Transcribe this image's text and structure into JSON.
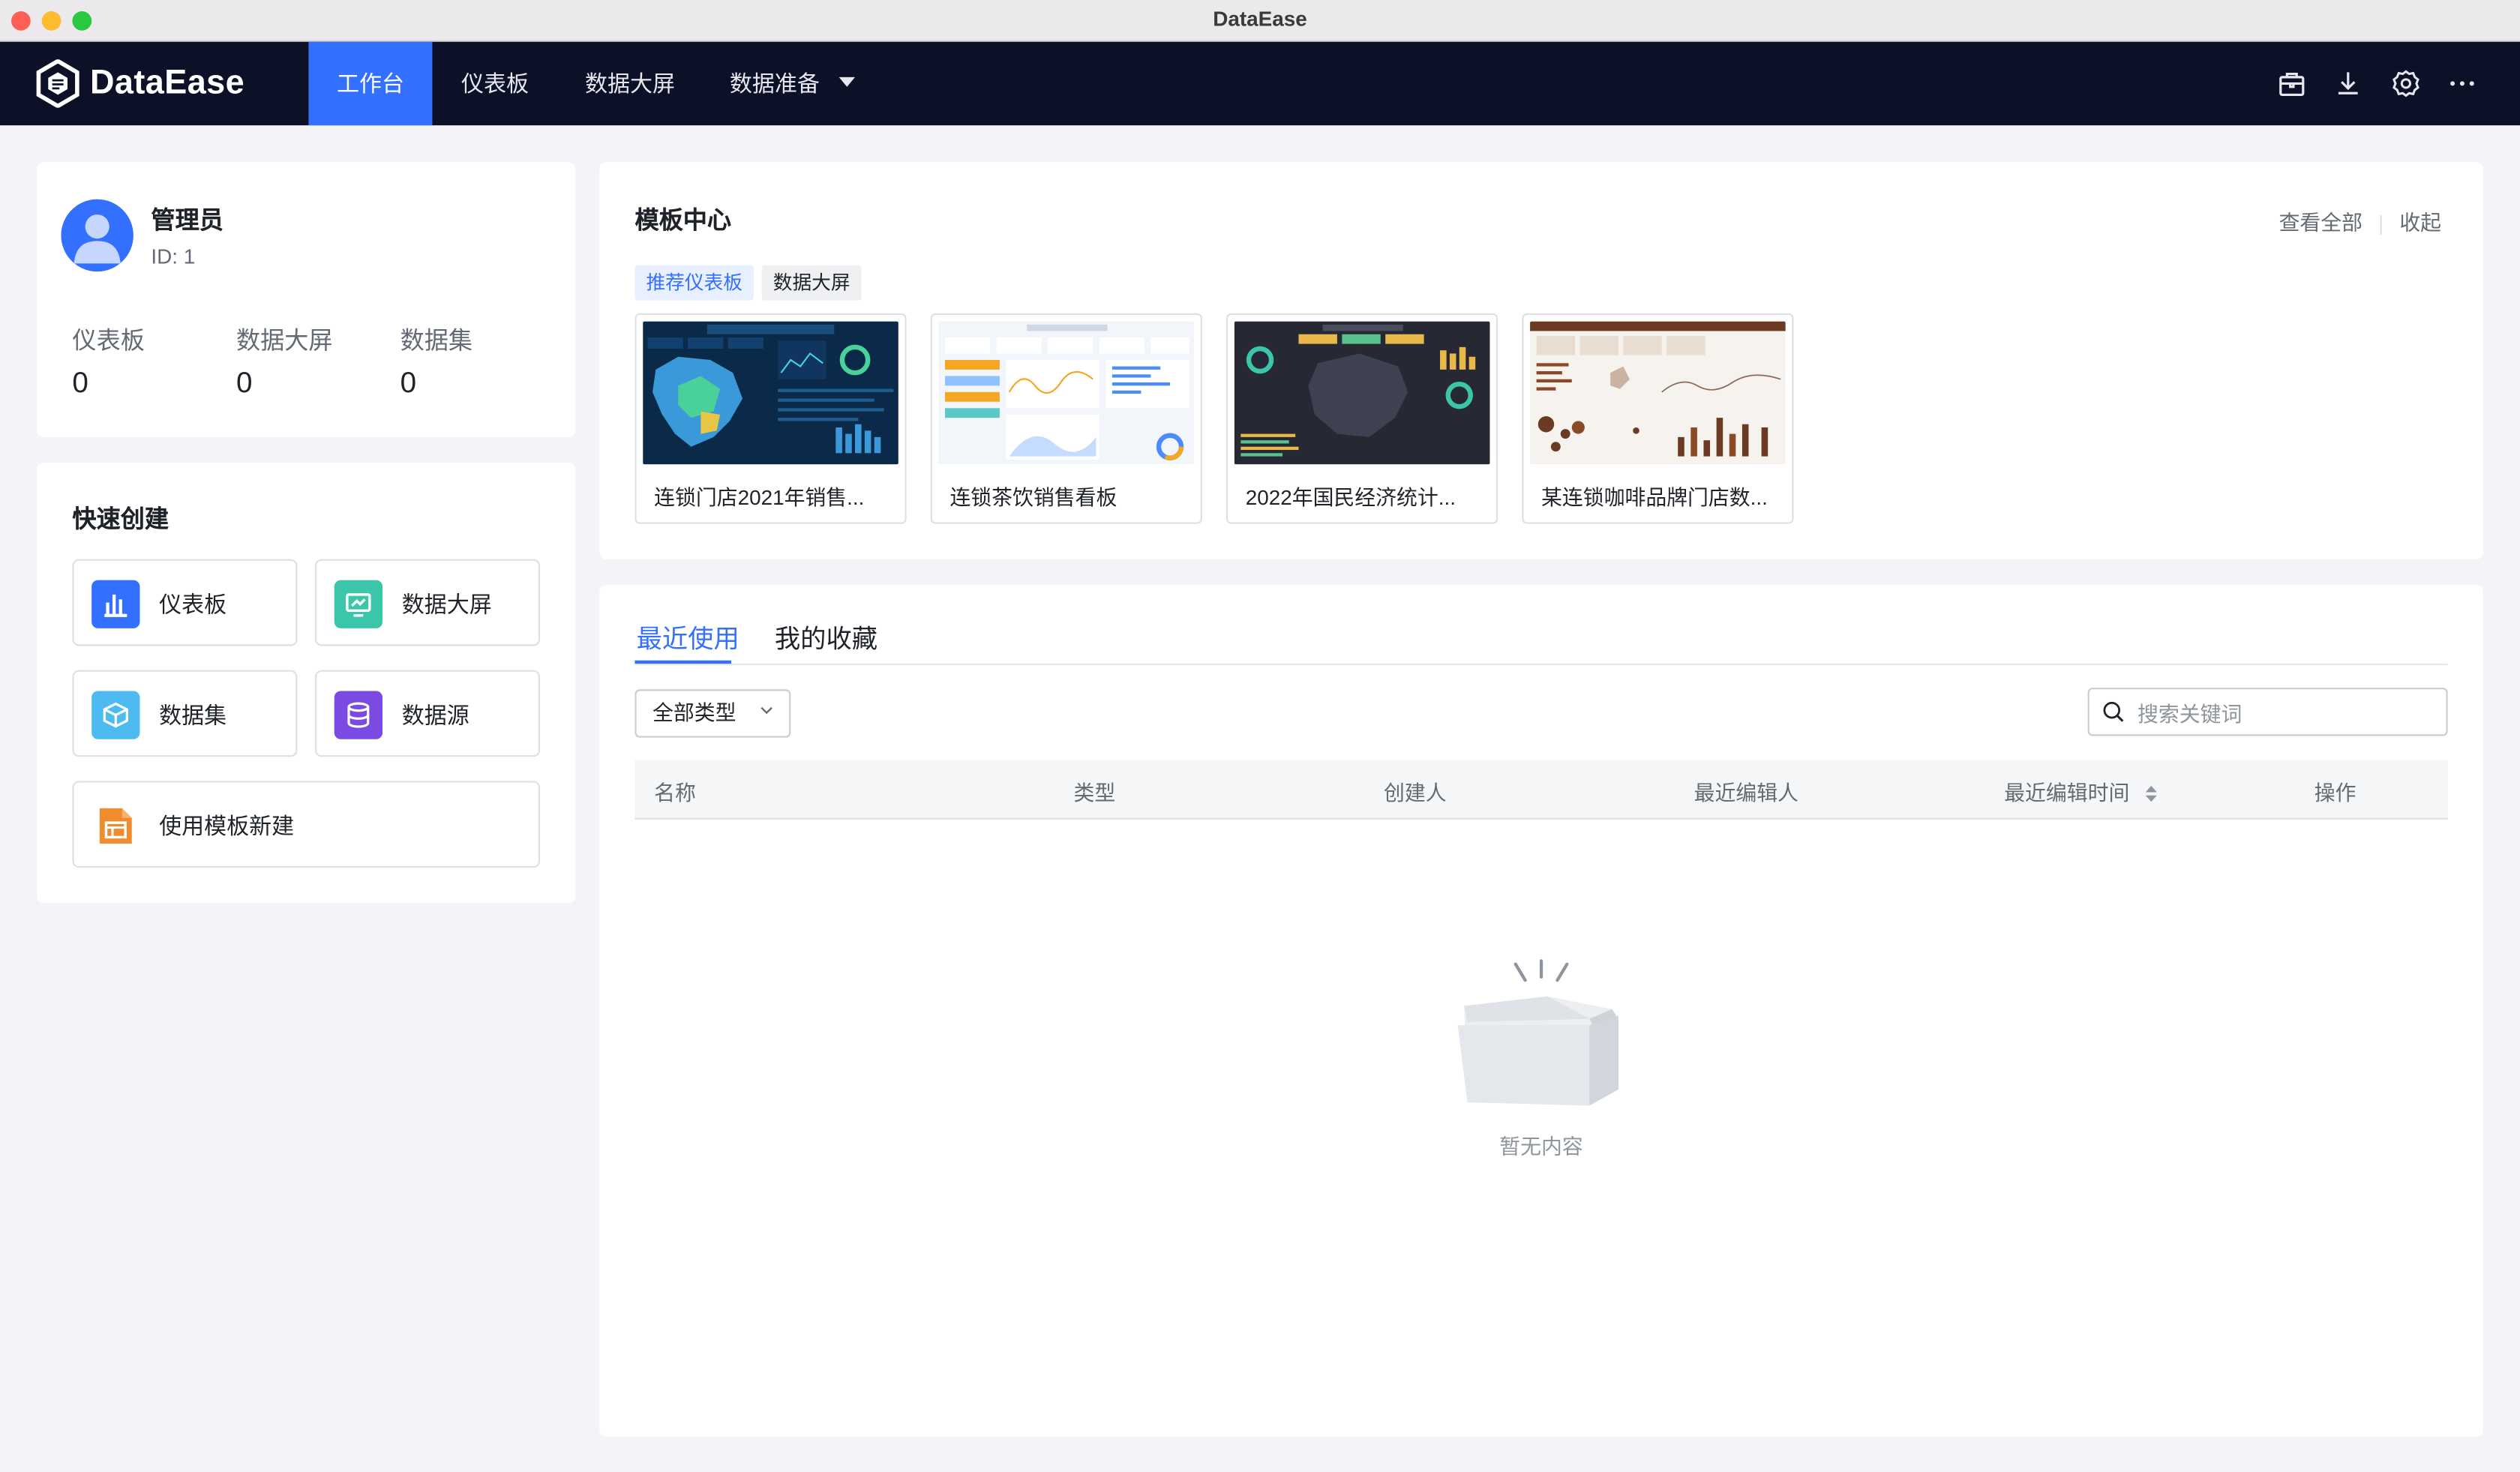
{
  "window": {
    "title": "DataEase"
  },
  "nav": {
    "logo_text": "DataEase",
    "items": [
      {
        "label": "工作台",
        "active": true
      },
      {
        "label": "仪表板"
      },
      {
        "label": "数据大屏"
      },
      {
        "label": "数据准备"
      }
    ],
    "right_icons": [
      "template-box-icon",
      "download-icon",
      "gear-icon",
      "more-icon"
    ]
  },
  "user": {
    "name": "管理员",
    "id_label": "ID: 1",
    "stats": [
      {
        "label": "仪表板",
        "value": "0"
      },
      {
        "label": "数据大屏",
        "value": "0"
      },
      {
        "label": "数据集",
        "value": "0"
      }
    ]
  },
  "quick_create": {
    "title": "快速创建",
    "items": [
      {
        "label": "仪表板",
        "icon": "bar-chart-icon",
        "color": "#3370ff"
      },
      {
        "label": "数据大屏",
        "icon": "screen-chart-icon",
        "color": "#3cc6a9"
      },
      {
        "label": "数据集",
        "icon": "cube-icon",
        "color": "#4dbaf0"
      },
      {
        "label": "数据源",
        "icon": "database-icon",
        "color": "#7b4ae2"
      },
      {
        "label": "使用模板新建",
        "icon": "template-icon",
        "color": "#f08c2e"
      }
    ]
  },
  "template_center": {
    "title": "模板中心",
    "view_all": "查看全部",
    "collapse": "收起",
    "tabs": [
      {
        "label": "推荐仪表板",
        "active": true
      },
      {
        "label": "数据大屏"
      }
    ],
    "templates": [
      {
        "name": "连锁门店2021年销售..."
      },
      {
        "name": "连锁茶饮销售看板"
      },
      {
        "name": "2022年国民经济统计..."
      },
      {
        "name": "某连锁咖啡品牌门店数..."
      }
    ]
  },
  "recent": {
    "tabs": [
      {
        "label": "最近使用",
        "active": true
      },
      {
        "label": "我的收藏"
      }
    ],
    "type_filter": "全部类型",
    "search_placeholder": "搜索关键词",
    "columns": [
      "名称",
      "类型",
      "创建人",
      "最近编辑人",
      "最近编辑时间",
      "操作"
    ],
    "empty_text": "暂无内容"
  },
  "colors": {
    "accent": "#3370ff",
    "nav_bg": "#0d1127",
    "page_bg": "#f3f4f7"
  }
}
